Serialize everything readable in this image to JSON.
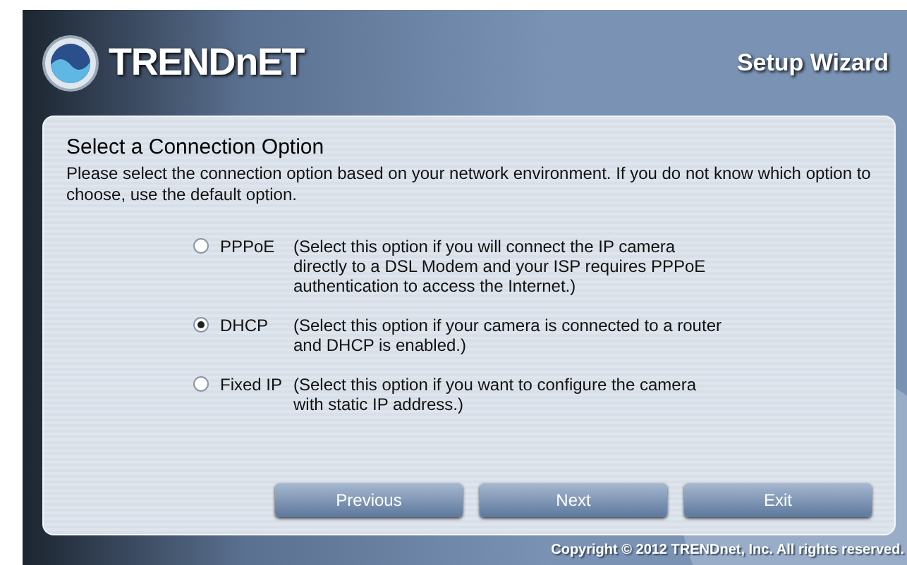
{
  "header": {
    "brand": "TRENDnET",
    "title": "Setup Wizard"
  },
  "panel": {
    "heading": "Select a Connection Option",
    "intro": "Please select the connection option based on your network environment. If you do not know which option to choose, use the default option.",
    "options": [
      {
        "label": "PPPoE",
        "description": "(Select this option if you will connect the IP camera directly to a DSL Modem and your ISP requires PPPoE authentication to access the Internet.)",
        "selected": false
      },
      {
        "label": "DHCP",
        "description": "(Select this option if your camera is connected to a router and DHCP is enabled.)",
        "selected": true
      },
      {
        "label": "Fixed IP",
        "description": "(Select this option if you want to configure the camera with static IP address.)",
        "selected": false
      }
    ],
    "buttons": [
      "Previous",
      "Next",
      "Exit"
    ]
  },
  "footer": {
    "copyright": "Copyright © 2012 TRENDnet, Inc. All rights reserved."
  }
}
